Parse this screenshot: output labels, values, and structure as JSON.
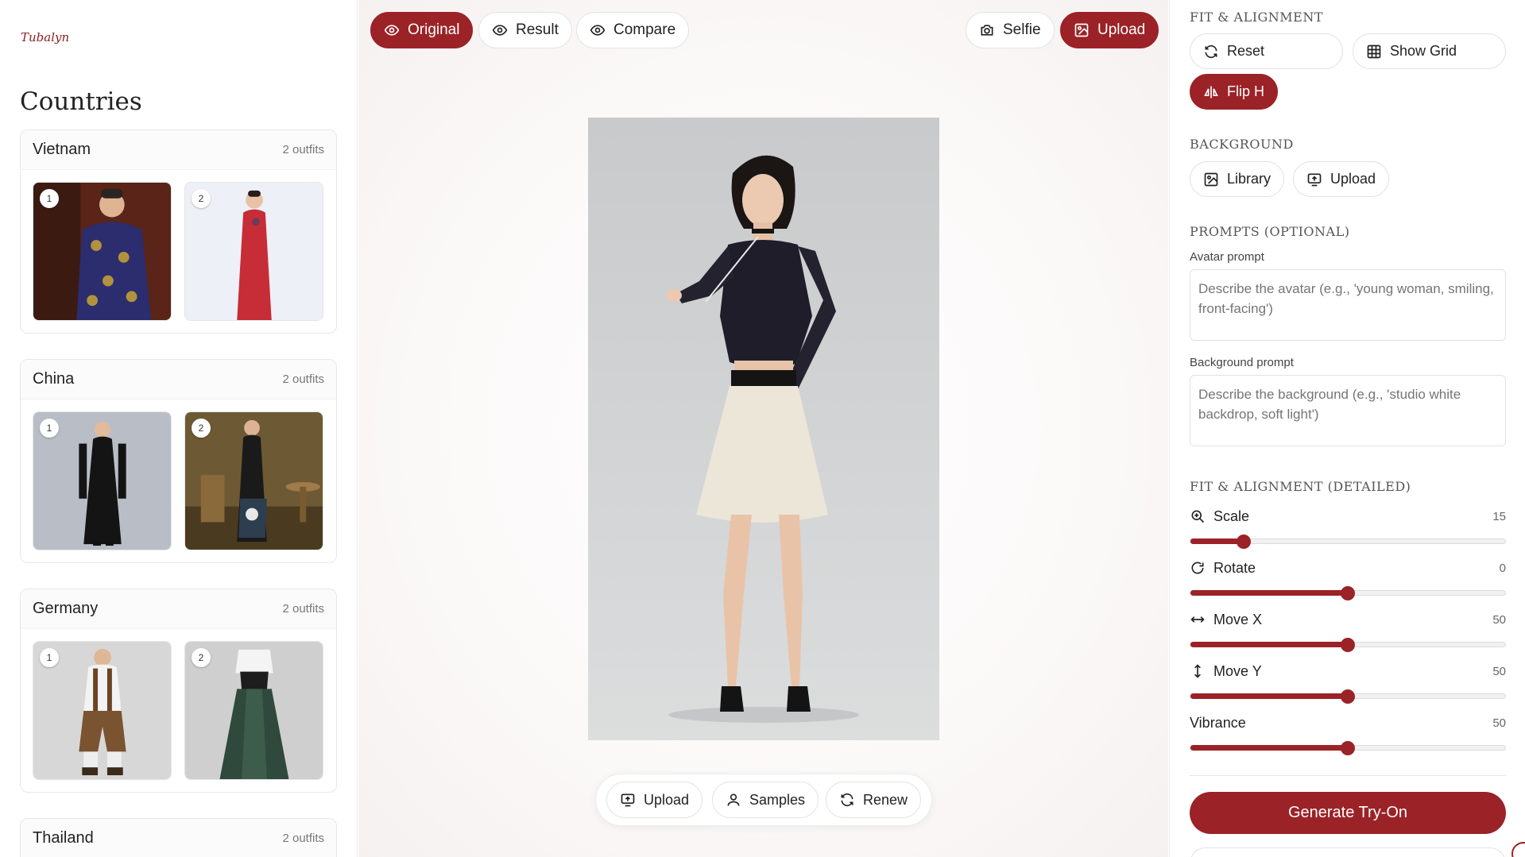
{
  "brand": {
    "logo_text": "Tubalyn"
  },
  "sidebar": {
    "title": "Countries",
    "countries": [
      {
        "name": "Vietnam",
        "count": "2 outfits",
        "outfits": [
          "1",
          "2"
        ]
      },
      {
        "name": "China",
        "count": "2 outfits",
        "outfits": [
          "1",
          "2"
        ]
      },
      {
        "name": "Germany",
        "count": "2 outfits",
        "outfits": [
          "1",
          "2"
        ]
      },
      {
        "name": "Thailand",
        "count": "2 outfits",
        "outfits": []
      }
    ]
  },
  "toolbar": {
    "original": "Original",
    "result": "Result",
    "compare": "Compare",
    "selfie": "Selfie",
    "upload": "Upload",
    "active_view": "Original"
  },
  "bottom_bar": {
    "upload": "Upload",
    "samples": "Samples",
    "renew": "Renew"
  },
  "right_panel": {
    "fit_title": "FIT & ALIGNMENT",
    "reset": "Reset",
    "show_grid": "Show Grid",
    "flip_h": "Flip H",
    "background_title": "BACKGROUND",
    "library": "Library",
    "bg_upload": "Upload",
    "prompts_title": "PROMPTS (OPTIONAL)",
    "avatar_label": "Avatar prompt",
    "avatar_placeholder": "Describe the avatar (e.g., 'young woman, smiling, front-facing')",
    "background_label": "Background prompt",
    "background_placeholder": "Describe the background (e.g., 'studio white backdrop, soft light')",
    "detailed_title": "FIT & ALIGNMENT (DETAILED)",
    "sliders": [
      {
        "name": "Scale",
        "value": "15",
        "fraction": 0.17,
        "icon": "zoom-in-icon"
      },
      {
        "name": "Rotate",
        "value": "0",
        "fraction": 0.5,
        "icon": "rotate-icon"
      },
      {
        "name": "Move X",
        "value": "50",
        "fraction": 0.5,
        "icon": "arrows-horizontal-icon"
      },
      {
        "name": "Move Y",
        "value": "50",
        "fraction": 0.5,
        "icon": "arrows-vertical-icon"
      },
      {
        "name": "Vibrance",
        "value": "50",
        "fraction": 0.5,
        "icon": ""
      }
    ],
    "generate": "Generate Try-On"
  },
  "colors": {
    "accent": "#9b2226",
    "border": "#e4e4e4"
  }
}
